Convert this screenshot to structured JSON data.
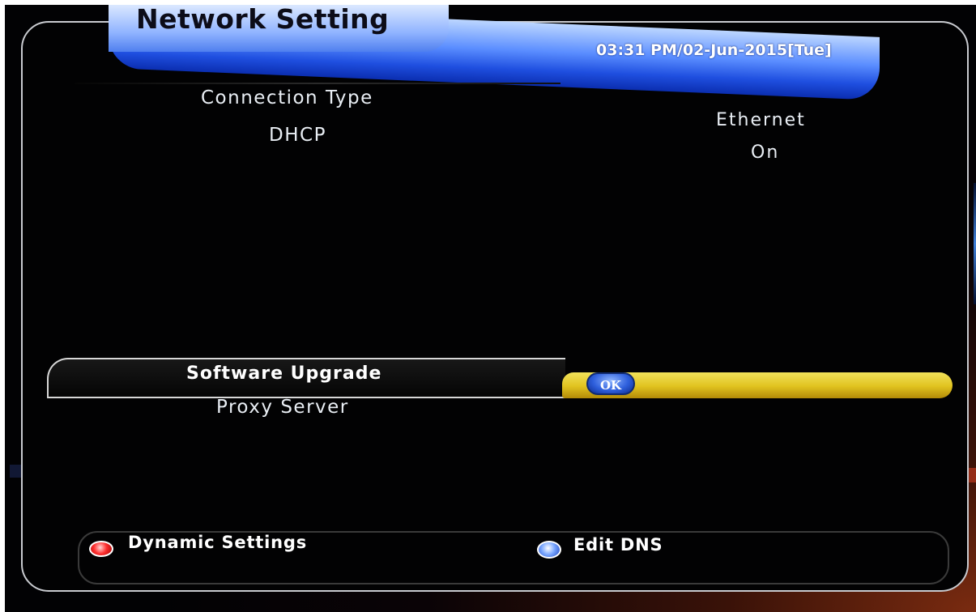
{
  "title": "Network Setting",
  "datetime": "03:31 PM/02-Jun-2015[Tue]",
  "settings": {
    "connection_type_label": "Connection Type",
    "connection_type_value": "Ethernet",
    "dhcp_label": "DHCP",
    "dhcp_value": "On",
    "software_upgrade_label": "Software Upgrade",
    "software_upgrade_button": "OK",
    "proxy_server_label": "Proxy Server"
  },
  "footer": {
    "red_key_label": "Dynamic Settings",
    "blue_key_label": "Edit DNS"
  },
  "colors": {
    "title_bar": "#3a6cff",
    "highlight": "#e6c62a",
    "ok_button": "#2e5fdc",
    "red_key": "#ff3030"
  }
}
